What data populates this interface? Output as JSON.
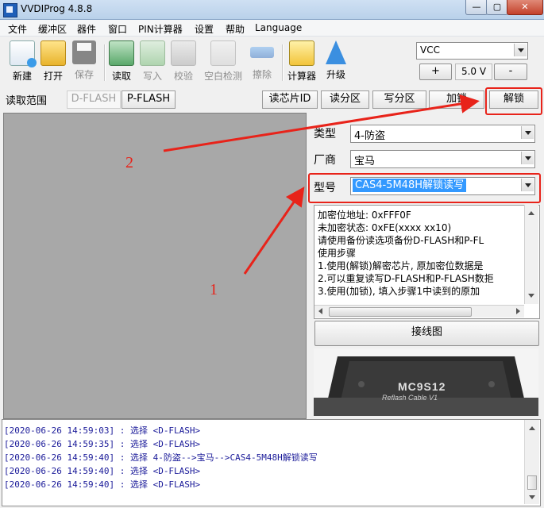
{
  "window": {
    "title": "VVDIProg 4.8.8",
    "min": "—",
    "max": "▢",
    "close": "✕"
  },
  "menu": [
    "文件",
    "缓冲区",
    "器件",
    "窗口",
    "PIN计算器",
    "设置",
    "帮助",
    "Language"
  ],
  "toolbar": {
    "new": "新建",
    "open": "打开",
    "save": "保存",
    "read": "读取",
    "write": "写入",
    "verify": "校验",
    "blank_check": "空白检测",
    "erase": "擦除",
    "calculator": "计算器",
    "upgrade": "升级"
  },
  "vcc": {
    "selected": "VCC",
    "plus": "+",
    "voltage": "5.0 V",
    "minus": "-"
  },
  "read_range": {
    "label": "读取范围",
    "dflash": "D-FLASH",
    "pflash": "P-FLASH"
  },
  "actions": {
    "read_id": "读芯片ID",
    "read_partition": "读分区",
    "write_partition": "写分区",
    "lock": "加锁",
    "unlock": "解锁"
  },
  "device": {
    "type_label": "类型",
    "type_value": "4-防盗",
    "maker_label": "厂商",
    "maker_value": "宝马",
    "model_label": "型号",
    "model_value": "CAS4-5M48H解锁读写"
  },
  "info_lines": [
    "加密位地址: 0xFFF0F",
    "未加密状态: 0xFE(xxxx xx10)",
    "请使用备份读选项备份D-FLASH和P-FL",
    "使用步骤",
    "1.使用(解锁)解密芯片, 原加密位数据是",
    "2.可以重复读写D-FLASH和P-FLASH数拒",
    "3.使用(加锁), 填入步骤1中读到的原加"
  ],
  "wiring_button": "接线图",
  "chip": {
    "title": "MC9S12",
    "subtitle": "Reflash Cable V1"
  },
  "log": [
    {
      "ts": "[2020-06-26 14:59:03]",
      "msg": " : 选择 <D-FLASH>"
    },
    {
      "ts": "[2020-06-26 14:59:35]",
      "msg": " : 选择 <D-FLASH>"
    },
    {
      "ts": "[2020-06-26 14:59:40]",
      "msg": " : 选择 4-防盗-->宝马-->CAS4-5M48H解锁读写"
    },
    {
      "ts": "[2020-06-26 14:59:40]",
      "msg": " : 选择 <D-FLASH>"
    },
    {
      "ts": "[2020-06-26 14:59:40]",
      "msg": " : 选择 <D-FLASH>"
    }
  ],
  "annotations": {
    "step1": "1",
    "step2": "2",
    "color": "#e8231a"
  },
  "colors": {
    "selection": "#3399ff",
    "hex_area": "#a8a8a8",
    "log_text": "#1a1a99"
  }
}
